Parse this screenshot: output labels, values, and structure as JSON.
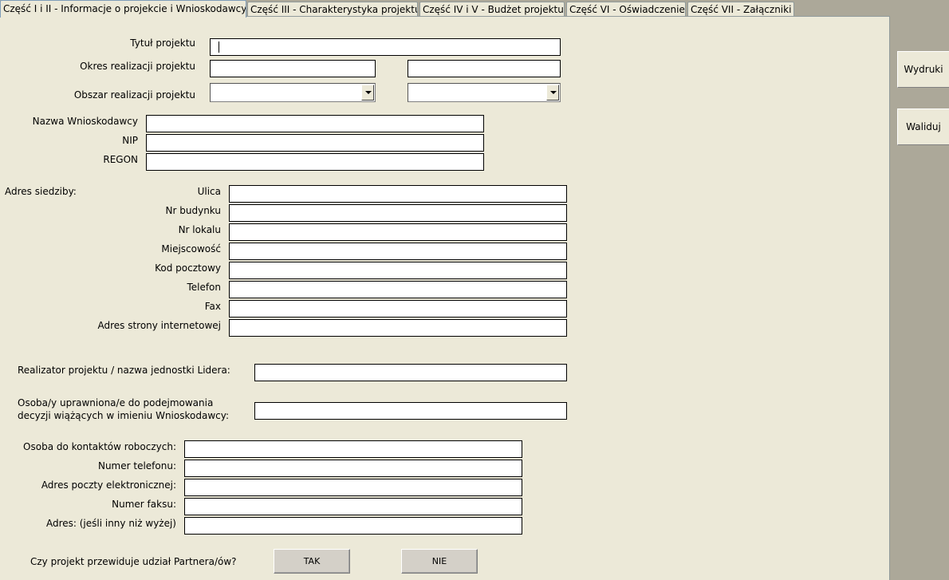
{
  "tabs": [
    {
      "label": "Część I i II - Informacje o projekcie i Wnioskodawcy"
    },
    {
      "label": "Część III - Charakterystyka projektu"
    },
    {
      "label": "Część IV i V - Budżet projektu"
    },
    {
      "label": "Część VI - Oświadczenie"
    },
    {
      "label": "Część VII - Załączniki"
    }
  ],
  "side_buttons": {
    "print": "Wydruki",
    "validate": "Waliduj"
  },
  "project": {
    "title_label": "Tytuł projektu",
    "period_label": "Okres realizacji projektu",
    "area_label": "Obszar realizacji projektu"
  },
  "applicant": {
    "name_label": "Nazwa Wnioskodawcy",
    "nip_label": "NIP",
    "regon_label": "REGON"
  },
  "address": {
    "section_label": "Adres siedziby:",
    "fields": [
      {
        "label": "Ulica"
      },
      {
        "label": "Nr budynku"
      },
      {
        "label": "Nr lokalu"
      },
      {
        "label": "Miejscowość"
      },
      {
        "label": "Kod pocztowy"
      },
      {
        "label": "Telefon"
      },
      {
        "label": "Fax"
      },
      {
        "label": "Adres strony internetowej"
      }
    ]
  },
  "leader_label": "Realizator projektu / nazwa jednostki Lidera:",
  "authorized_label": "Osoba/y uprawniona/e do podejmowania decyzji wiążących w imieniu Wnioskodawcy:",
  "contact": {
    "fields": [
      {
        "label": "Osoba do kontaktów roboczych:"
      },
      {
        "label": "Numer telefonu:"
      },
      {
        "label": "Adres poczty elektronicznej:"
      },
      {
        "label": "Numer faksu:"
      },
      {
        "label": "Adres: (jeśli inny niż wyżej)"
      }
    ]
  },
  "partner": {
    "question": "Czy projekt przewiduje udział Partnera/ów?",
    "yes": "TAK",
    "no": "NIE"
  }
}
